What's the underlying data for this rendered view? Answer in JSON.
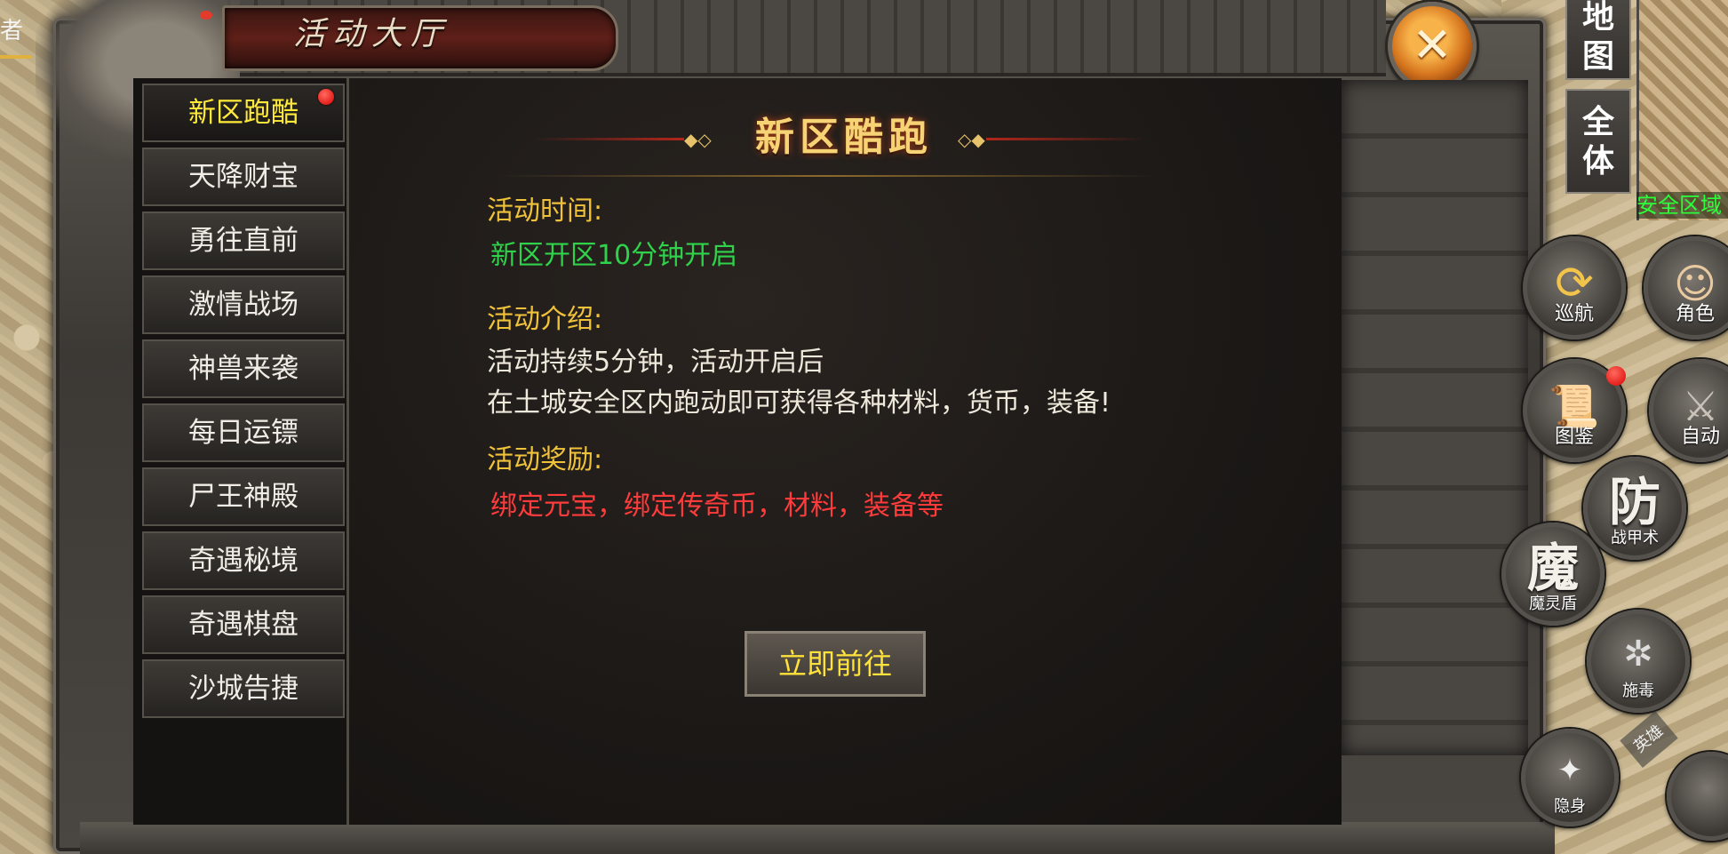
{
  "window": {
    "title": "活动大厅",
    "close_icon": "close-icon"
  },
  "corner": {
    "text": "者"
  },
  "sidebar": {
    "items": [
      {
        "label": "新区跑酷",
        "active": true,
        "has_alert": true
      },
      {
        "label": "天降财宝"
      },
      {
        "label": "勇往直前"
      },
      {
        "label": "激情战场"
      },
      {
        "label": "神兽来袭"
      },
      {
        "label": "每日运镖"
      },
      {
        "label": "尸王神殿"
      },
      {
        "label": "奇遇秘境"
      },
      {
        "label": "奇遇棋盘"
      },
      {
        "label": "沙城告捷"
      }
    ]
  },
  "detail": {
    "heading": "新区酷跑",
    "time_label": "活动时间:",
    "time_value": "新区开区10分钟开启",
    "intro_label": "活动介绍:",
    "intro_line1": "活动持续5分钟，活动开启后",
    "intro_line2": "在土城安全区内跑动即可获得各种材料，货币，装备!",
    "reward_label": "活动奖励:",
    "reward_value": "绑定元宝，绑定传奇币，材料，装备等",
    "go_button": "立即前往"
  },
  "hud": {
    "map_button": "地图",
    "all_button": "全体",
    "safe_zone": "安全区域",
    "skills": {
      "patrol": "巡航",
      "character": "角色",
      "atlas": "图鉴",
      "auto": "自动",
      "defense_glyph": "防",
      "defense_label": "战甲术",
      "magic_glyph": "魔",
      "magic_label": "魔灵盾",
      "poison_label": "施毒",
      "bottom_label": "隐身",
      "side_tab": "英雄"
    }
  },
  "colors": {
    "accent_yellow": "#ffea3a",
    "label_gold": "#f0c23a",
    "time_green": "#2fd24a",
    "reward_red": "#ff3b3b",
    "alert_red": "#d90000",
    "close_orange": "#e0851f"
  }
}
